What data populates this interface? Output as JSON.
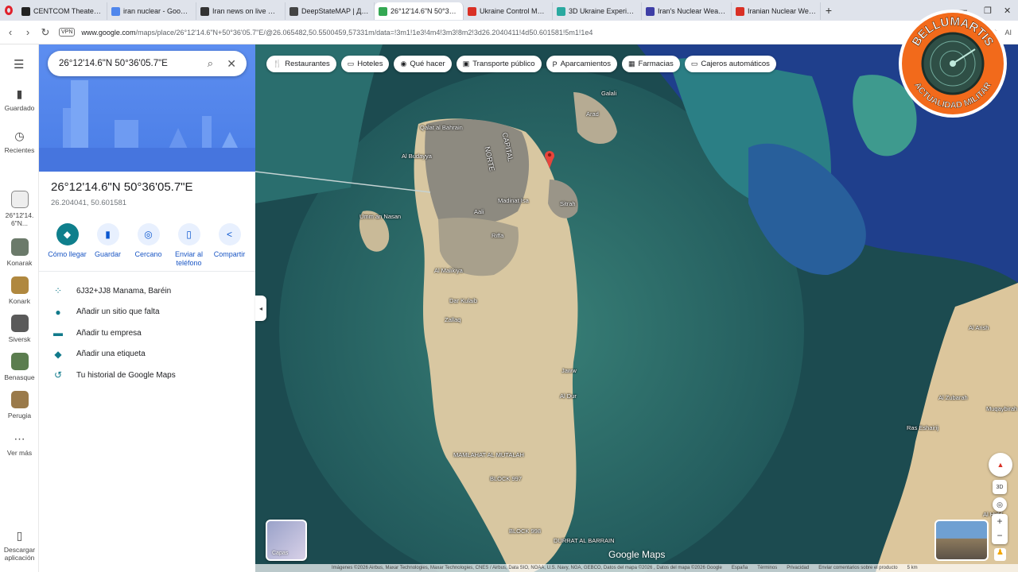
{
  "tabs": [
    {
      "label": "CENTCOM Theater Operat",
      "color": "#222222"
    },
    {
      "label": "iran nuclear - Google Eart",
      "color": "#4f86ec"
    },
    {
      "label": "Iran news on live map in I",
      "color": "#333333"
    },
    {
      "label": "DeepStateMAP | День 14",
      "color": "#444444"
    },
    {
      "label": "26°12'14.6\"N 50°36'05.7\"",
      "color": "#34a853",
      "active": true
    },
    {
      "label": "Ukraine Control Map v2",
      "color": "#d93025"
    },
    {
      "label": "3D Ukraine Experience",
      "color": "#2aa9a0"
    },
    {
      "label": "Iran's Nuclear Weapons",
      "color": "#3e3ea6"
    },
    {
      "label": "Iranian Nuclear Weapons",
      "color": "#d93025"
    }
  ],
  "browser": {
    "new_tab": "+",
    "vpn": "VPN",
    "url_domain": "www.google.com",
    "url_rest": "/maps/place/26°12'14.6\"N+50°36'05.7\"E/@26.065482,50.5500459,57331m/data=!3m1!1e3!4m4!3m3!8m2!3d26.2040411!4d50.601581!5m1!1e4",
    "ai": "AI"
  },
  "rail": {
    "saved": "Guardado",
    "recent": "Recientes",
    "current": "26°12'14.6\"N...",
    "places": [
      "Konarak",
      "Konark",
      "Siversk",
      "Benasque",
      "Perugia"
    ],
    "more": "Ver más",
    "download": "Descargar aplicación"
  },
  "search": {
    "value": "26°12'14.6\"N 50°36'05.7\"E"
  },
  "place": {
    "title": "26°12'14.6\"N 50°36'05.7\"E",
    "decimal": "26.204041, 50.601581"
  },
  "actions": [
    {
      "label": "Cómo llegar",
      "icon": "directions-icon",
      "glyph": "◆"
    },
    {
      "label": "Guardar",
      "icon": "bookmark-icon",
      "glyph": "▮"
    },
    {
      "label": "Cercano",
      "icon": "nearby-icon",
      "glyph": "◎"
    },
    {
      "label": "Enviar al teléfono",
      "icon": "phone-icon",
      "glyph": "▯"
    },
    {
      "label": "Compartir",
      "icon": "share-icon",
      "glyph": "<"
    }
  ],
  "info": [
    {
      "label": "6J32+JJ8 Manama, Baréin",
      "icon": "plus-code-icon",
      "glyph": "⁘"
    },
    {
      "label": "Añadir un sitio que falta",
      "icon": "add-place-icon",
      "glyph": "●"
    },
    {
      "label": "Añadir tu empresa",
      "icon": "store-icon",
      "glyph": "▬"
    },
    {
      "label": "Añadir una etiqueta",
      "icon": "label-icon",
      "glyph": "◆"
    },
    {
      "label": "Tu historial de Google Maps",
      "icon": "history-icon",
      "glyph": "↺"
    }
  ],
  "chips": [
    {
      "label": "Restaurantes",
      "glyph": "🍴"
    },
    {
      "label": "Hoteles",
      "glyph": "▭"
    },
    {
      "label": "Qué hacer",
      "glyph": "◉"
    },
    {
      "label": "Transporte público",
      "glyph": "▣"
    },
    {
      "label": "Aparcamientos",
      "glyph": "P"
    },
    {
      "label": "Farmacias",
      "glyph": "▦"
    },
    {
      "label": "Cajeros automáticos",
      "glyph": "▭"
    }
  ],
  "map_labels": [
    "Galali",
    "Arad",
    "Qalat al Bahrain",
    "Al Budayya",
    "NORTE",
    "CAPITAL",
    "Madinat Isa",
    "Aali",
    "Riffa",
    "Sitrah",
    "Umm an Nasan",
    "Al Malikiya",
    "Dar Kulaib",
    "Zallaq",
    "Jaww",
    "Al Dur",
    "MAMLAHAT AL MUTALAH",
    "BLOCK 997",
    "BLOCK 998",
    "DURRAT AL BARRAIN",
    "Al Arish",
    "Al Zubarah",
    "Ras Eshairij",
    "Muqaybirah",
    "Al Hidd"
  ],
  "map": {
    "layers": "Capas",
    "brand": "Google Maps",
    "attribution": "Imágenes ©2026 Airbus, Maxar Technologies, Maxar Technologies, CNES / Airbus, Data SIO, NOAA, U.S. Navy, NGA, GEBCO, Datos del mapa ©2026 , Datos del mapa ©2026 Google",
    "region": "España",
    "terms": "Términos",
    "privacy": "Privacidad",
    "feedback": "Enviar comentarios sobre el producto",
    "scale": "5 km",
    "mode_3d": "3D"
  },
  "logo": {
    "top": "BELLUMARTIS",
    "bottom": "ACTUALIDAD MILITAR"
  },
  "colors": {
    "accent": "#1a73e8",
    "teal": "#117a8b",
    "logo_orange": "#f26a1b"
  }
}
